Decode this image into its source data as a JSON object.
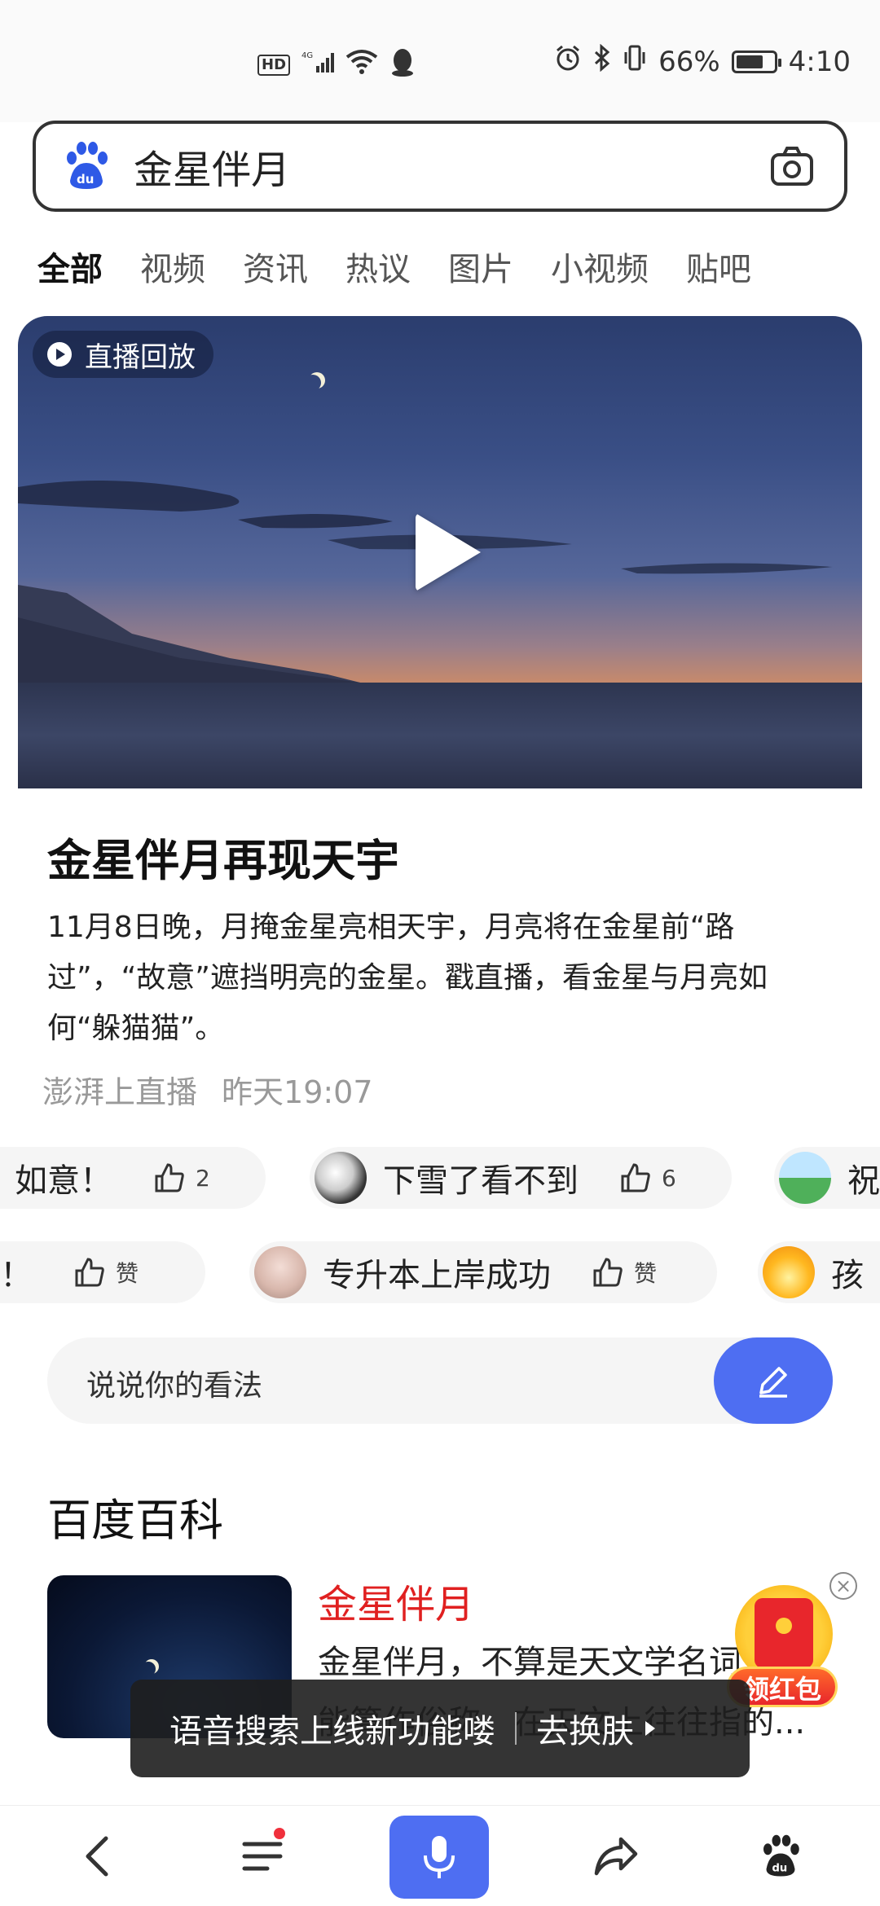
{
  "status_bar": {
    "hd": "HD",
    "net": "4G",
    "battery_pct": "66%",
    "time": "4:10"
  },
  "search": {
    "query": "金星伴月"
  },
  "tabs": [
    "全部",
    "视频",
    "资讯",
    "热议",
    "图片",
    "小视频",
    "贴吧"
  ],
  "video": {
    "badge": "直播回放",
    "title": "金星伴月再现天宇",
    "description": "11月8日晚，月掩金星亮相天宇，月亮将在金星前“路过”，“故意”遮挡明亮的金星。戳直播，看金星与月亮如何“躲猫猫”。",
    "source": "澎湃上直播",
    "time": "昨天19:07"
  },
  "comments_row1": [
    {
      "text": "如意！",
      "likes": "2"
    },
    {
      "text": "下雪了看不到",
      "likes": "6"
    },
    {
      "text": "祝",
      "likes": ""
    }
  ],
  "comments_row2": [
    {
      "text": "！",
      "likes": "赞"
    },
    {
      "text": "专升本上岸成功",
      "likes": "赞"
    },
    {
      "text": "孩",
      "likes": ""
    }
  ],
  "opinion": {
    "placeholder": "说说你的看法"
  },
  "baike": {
    "section_title": "百度百科",
    "title": "金星伴月",
    "line1": "金星伴月，不算是天文学名词",
    "line2": "能算作俗称，在天文上往往指的..."
  },
  "red_packet": {
    "label": "领红包"
  },
  "toast": {
    "message": "语音搜索上线新功能喽",
    "action": "去换肤"
  },
  "colors": {
    "accent": "#4e6ef2",
    "baike_title": "#e02020"
  }
}
